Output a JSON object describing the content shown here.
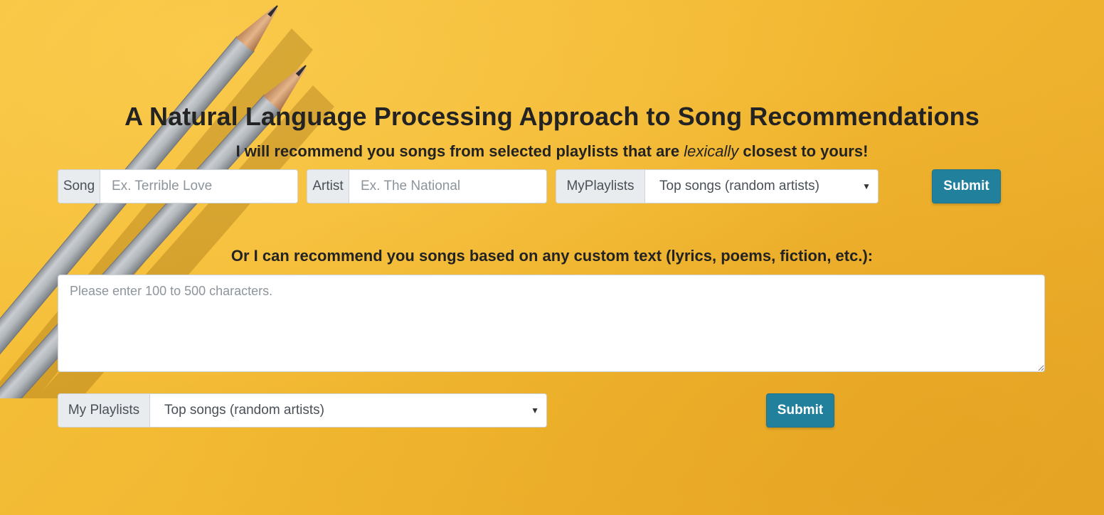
{
  "page": {
    "title": "A Natural Language Processing Approach to Song Recommendations",
    "subtitle_before": "I will recommend you songs from selected playlists that are ",
    "subtitle_emphasis": "lexically",
    "subtitle_after": " closest to yours!"
  },
  "song_form": {
    "song_label": "Song",
    "song_placeholder": "Ex. Terrible Love",
    "artist_label": "Artist",
    "artist_placeholder": "Ex. The National",
    "playlist_label": "MyPlaylists",
    "playlist_selected": "Top songs (random artists)",
    "submit_label": "Submit"
  },
  "text_form": {
    "heading": "Or I can recommend you songs based on any custom text (lyrics, poems, fiction, etc.):",
    "textarea_placeholder": "Please enter 100 to 500 characters.",
    "playlist_label": "My Playlists",
    "playlist_selected": "Top songs (random artists)",
    "submit_label": "Submit"
  },
  "colors": {
    "background": "#f2b935",
    "button": "#21809c",
    "text": "#232323",
    "addon_background": "#e9ecef"
  },
  "icons": {
    "dropdown": "chevron-down-icon",
    "background_image": "pencils-illustration"
  }
}
